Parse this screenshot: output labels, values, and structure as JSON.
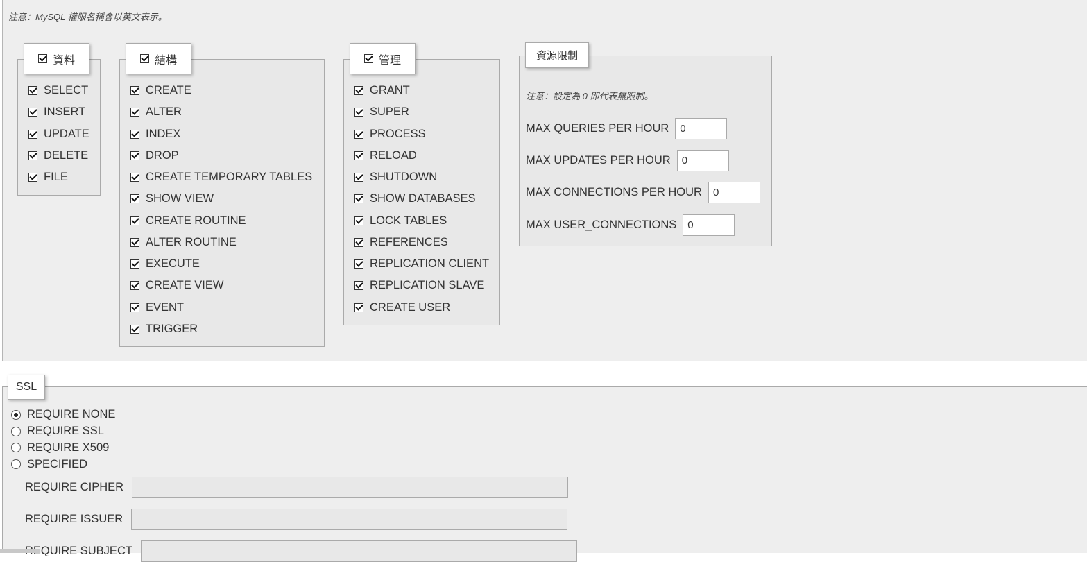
{
  "note_main": "注意：MySQL 權限名稱會以英文表示。",
  "data_group": {
    "legend": "資料",
    "checked": true,
    "items": [
      {
        "label": "SELECT",
        "checked": true
      },
      {
        "label": "INSERT",
        "checked": true
      },
      {
        "label": "UPDATE",
        "checked": true
      },
      {
        "label": "DELETE",
        "checked": true
      },
      {
        "label": "FILE",
        "checked": true
      }
    ]
  },
  "structure_group": {
    "legend": "結構",
    "checked": true,
    "items": [
      {
        "label": "CREATE",
        "checked": true
      },
      {
        "label": "ALTER",
        "checked": true
      },
      {
        "label": "INDEX",
        "checked": true
      },
      {
        "label": "DROP",
        "checked": true
      },
      {
        "label": "CREATE TEMPORARY TABLES",
        "checked": true
      },
      {
        "label": "SHOW VIEW",
        "checked": true
      },
      {
        "label": "CREATE ROUTINE",
        "checked": true
      },
      {
        "label": "ALTER ROUTINE",
        "checked": true
      },
      {
        "label": "EXECUTE",
        "checked": true
      },
      {
        "label": "CREATE VIEW",
        "checked": true
      },
      {
        "label": "EVENT",
        "checked": true
      },
      {
        "label": "TRIGGER",
        "checked": true
      }
    ]
  },
  "admin_group": {
    "legend": "管理",
    "checked": true,
    "items": [
      {
        "label": "GRANT",
        "checked": true
      },
      {
        "label": "SUPER",
        "checked": true
      },
      {
        "label": "PROCESS",
        "checked": true
      },
      {
        "label": "RELOAD",
        "checked": true
      },
      {
        "label": "SHUTDOWN",
        "checked": true
      },
      {
        "label": "SHOW DATABASES",
        "checked": true
      },
      {
        "label": "LOCK TABLES",
        "checked": true
      },
      {
        "label": "REFERENCES",
        "checked": true
      },
      {
        "label": "REPLICATION CLIENT",
        "checked": true
      },
      {
        "label": "REPLICATION SLAVE",
        "checked": true
      },
      {
        "label": "CREATE USER",
        "checked": true
      }
    ]
  },
  "resource_limits": {
    "legend": "資源限制",
    "note": "注意：設定為 0 即代表無限制。",
    "max_queries_label": "MAX QUERIES PER HOUR",
    "max_queries_value": "0",
    "max_updates_label": "MAX UPDATES PER HOUR",
    "max_updates_value": "0",
    "max_connections_label": "MAX CONNECTIONS PER HOUR",
    "max_connections_value": "0",
    "max_user_connections_label": "MAX USER_CONNECTIONS",
    "max_user_connections_value": "0"
  },
  "ssl": {
    "legend": "SSL",
    "options": [
      {
        "label": "REQUIRE NONE",
        "selected": true
      },
      {
        "label": "REQUIRE SSL",
        "selected": false
      },
      {
        "label": "REQUIRE X509",
        "selected": false
      },
      {
        "label": "SPECIFIED",
        "selected": false
      }
    ],
    "require_cipher_label": "REQUIRE CIPHER",
    "require_cipher_value": "",
    "require_issuer_label": "REQUIRE ISSUER",
    "require_issuer_value": "",
    "require_subject_label": "REQUIRE SUBJECT",
    "require_subject_value": ""
  },
  "colors": {
    "panel_bg": "#eeeeee",
    "fieldset_bg": "#e8e8e8",
    "border": "#aaaaaa",
    "text": "#333333"
  }
}
